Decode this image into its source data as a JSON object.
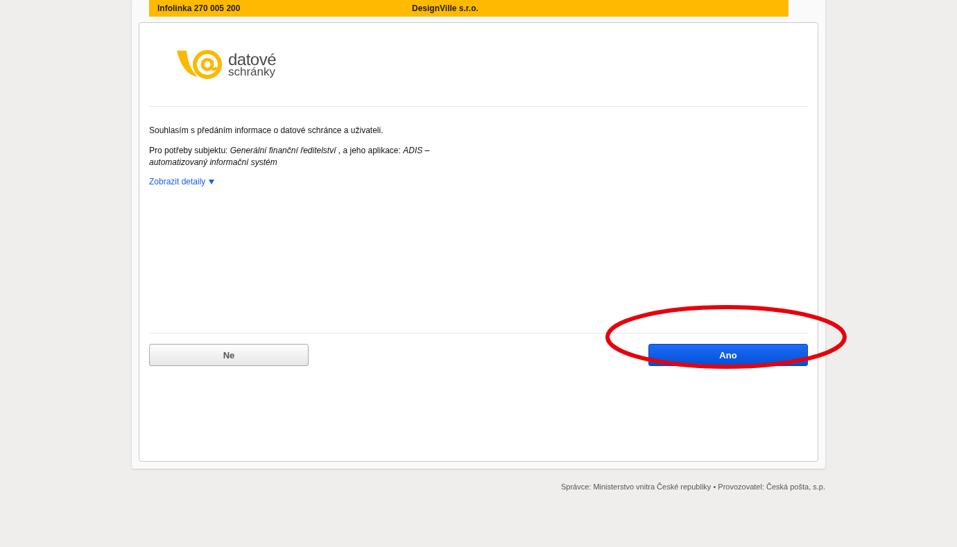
{
  "top_bar": {
    "hotline": "Infolinka 270 005 200",
    "user": "DesignVille s.r.o."
  },
  "logo": {
    "line_1": "datové",
    "line_2": "schránky"
  },
  "consent": {
    "statement": "Souhlasím s předáním informace o datové schránce a uživateli.",
    "purpose": "Pro potřeby subjektu: *Generální finanční ředitelství* , a jeho aplikace: *ADIS – automatizovaný informační systém*",
    "details_link": "Zobrazit detaily",
    "details_expanded": false
  },
  "buttons": [
    {
      "label": "Ne",
      "kind": "secondary"
    },
    {
      "label": "Ano",
      "kind": "primary"
    }
  ],
  "footer": "Správce: Ministerstvo vnitra České republiky • Provozovatel: Česká pošta, s.p."
}
